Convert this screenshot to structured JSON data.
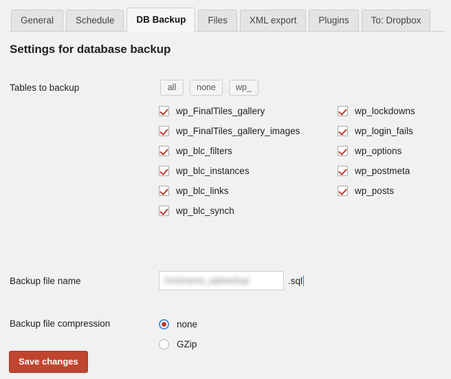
{
  "tabs": [
    {
      "label": "General",
      "active": false
    },
    {
      "label": "Schedule",
      "active": false
    },
    {
      "label": "DB Backup",
      "active": true
    },
    {
      "label": "Files",
      "active": false
    },
    {
      "label": "XML export",
      "active": false
    },
    {
      "label": "Plugins",
      "active": false
    },
    {
      "label": "To: Dropbox",
      "active": false
    }
  ],
  "page": {
    "title": "Settings for database backup"
  },
  "tables_section": {
    "label": "Tables to backup",
    "quick_buttons": [
      {
        "label": "all"
      },
      {
        "label": "none"
      },
      {
        "label": "wp_"
      }
    ],
    "left_column": [
      {
        "label": "wp_FinalTiles_gallery",
        "checked": true
      },
      {
        "label": "wp_FinalTiles_gallery_images",
        "checked": true
      },
      {
        "label": "wp_blc_filters",
        "checked": true
      },
      {
        "label": "wp_blc_instances",
        "checked": true
      },
      {
        "label": "wp_blc_links",
        "checked": true
      },
      {
        "label": "wp_blc_synch",
        "checked": true
      }
    ],
    "right_column": [
      {
        "label": "wp_lockdowns",
        "checked": true
      },
      {
        "label": "wp_login_fails",
        "checked": true
      },
      {
        "label": "wp_options",
        "checked": true
      },
      {
        "label": "wp_postmeta",
        "checked": true
      },
      {
        "label": "wp_posts",
        "checked": true
      }
    ]
  },
  "filename_section": {
    "label": "Backup file name",
    "value": "hostname_wpbackup",
    "placeholder": "",
    "suffix": ".sql"
  },
  "compression_section": {
    "label": "Backup file compression",
    "options": [
      {
        "label": "none",
        "selected": true
      },
      {
        "label": "GZip",
        "selected": false
      }
    ]
  },
  "footer": {
    "save_label": "Save changes"
  },
  "colors": {
    "accent_red": "#c0452f",
    "check_red": "#c0392b",
    "focus_blue": "#4a90d9",
    "background": "#f1f1f1",
    "tab_inactive": "#e4e4e4",
    "tab_active": "#f6f6f6"
  }
}
